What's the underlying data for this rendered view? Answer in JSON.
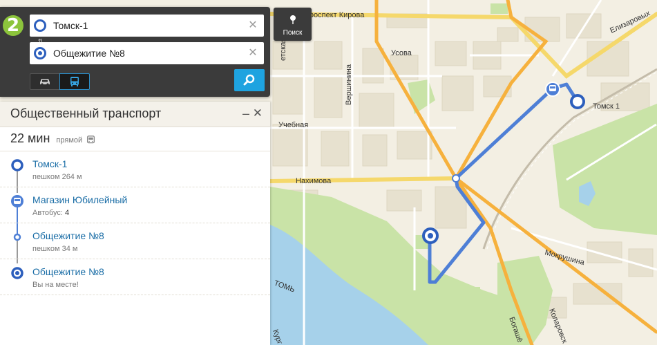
{
  "map": {
    "streets": {
      "prospekt_kirova": "Проспект Кирова",
      "usova": "Усова",
      "vershinina": "Вершинина",
      "uchebnaya": "Учебная",
      "nakhimova": "Нахимова",
      "mokrushina": "Мокрушина",
      "elizarovykh": "Елизаровых",
      "sovetskaya": "етская",
      "kolarovskaya": "Коларовск",
      "bogashevskoe": "Богашё",
      "tom": "ТОМЬ",
      "kurgan": "Кург"
    },
    "station_label": "Томск 1"
  },
  "search": {
    "from_value": "Томск-1",
    "to_value": "Общежитие №8",
    "clear_label": "✕",
    "poisk_label": "Поиск"
  },
  "route_panel": {
    "title": "Общественный транспорт",
    "minimize": "–",
    "close": "✕",
    "duration": "22 мин",
    "kind": "прямой",
    "steps": [
      {
        "title": "Томск-1",
        "sub": "пешком 264 м"
      },
      {
        "title": "Магазин Юбилейный",
        "sub_prefix": "Автобус:",
        "sub_value": "4"
      },
      {
        "title": "Общежитие №8",
        "sub": "пешком 34 м"
      },
      {
        "title": "Общежитие №8",
        "sub": "Вы на месте!"
      }
    ]
  },
  "colors": {
    "route": "#4e7fd6",
    "marker": "#2d5fbd",
    "accent": "#1ea3e0",
    "logo": "#8cc43c"
  },
  "icons": [
    "2gis-logo-icon",
    "swap-icon",
    "car-icon",
    "bus-icon",
    "search-icon",
    "pin-icon",
    "walk-dot-icon"
  ]
}
